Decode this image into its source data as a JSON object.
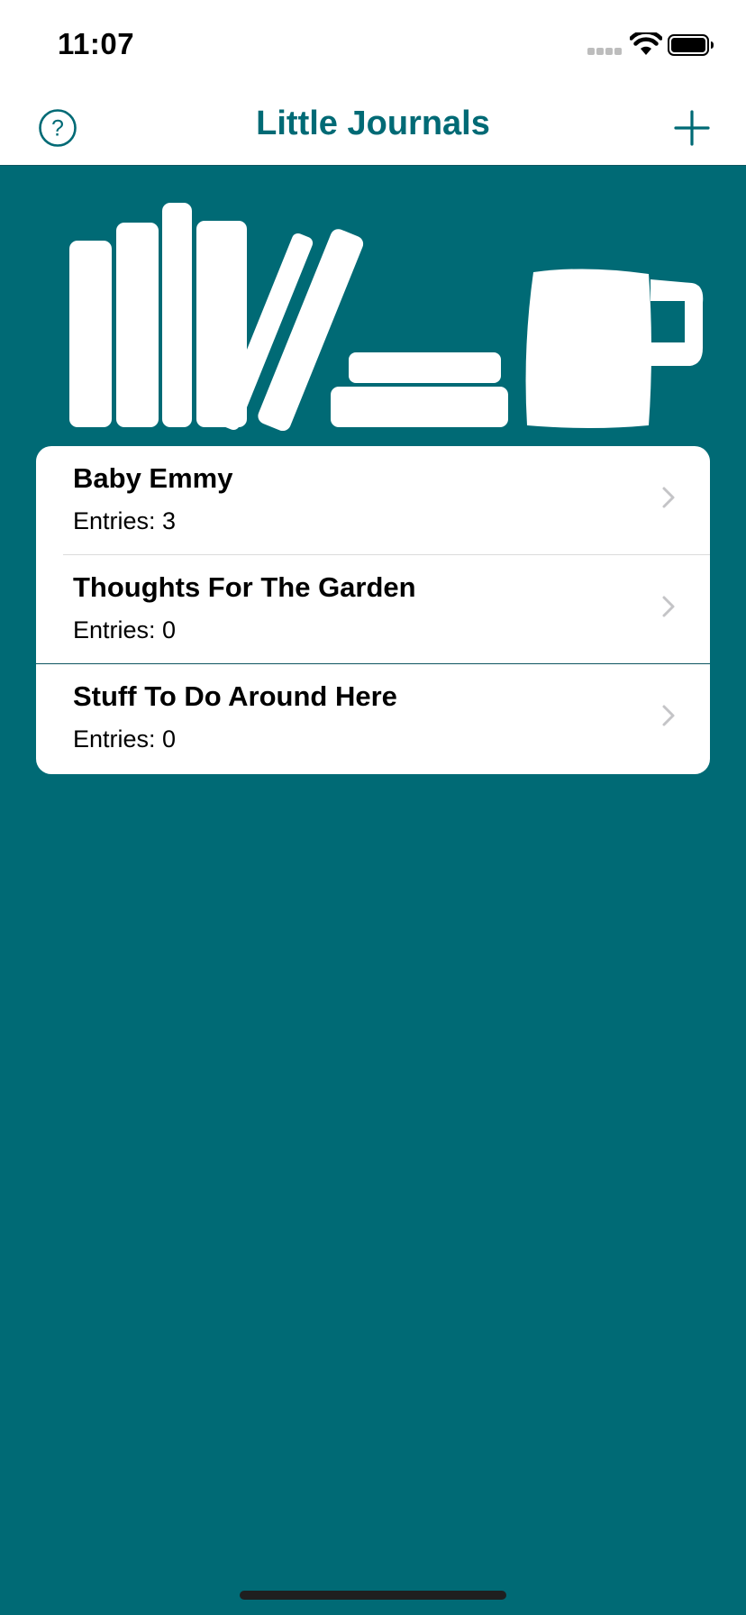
{
  "status_bar": {
    "time": "11:07",
    "signal_icon": "cellular-signal-icon",
    "wifi_icon": "wifi-icon",
    "battery_icon": "battery-full-icon"
  },
  "nav": {
    "title": "Little Journals",
    "left_button_icon": "help-circle-icon",
    "right_button_icon": "plus-icon"
  },
  "header_art_icon": "books-and-mug-icon",
  "journals": [
    {
      "name": "Baby Emmy",
      "entries_label": "Entries: 3"
    },
    {
      "name": "Thoughts For The Garden",
      "entries_label": "Entries: 0"
    },
    {
      "name": "Stuff To Do Around Here",
      "entries_label": "Entries: 0"
    }
  ],
  "colors": {
    "accent": "#006a75",
    "card": "#ffffff",
    "text": "#000000",
    "chevron": "#c4c4c7"
  }
}
